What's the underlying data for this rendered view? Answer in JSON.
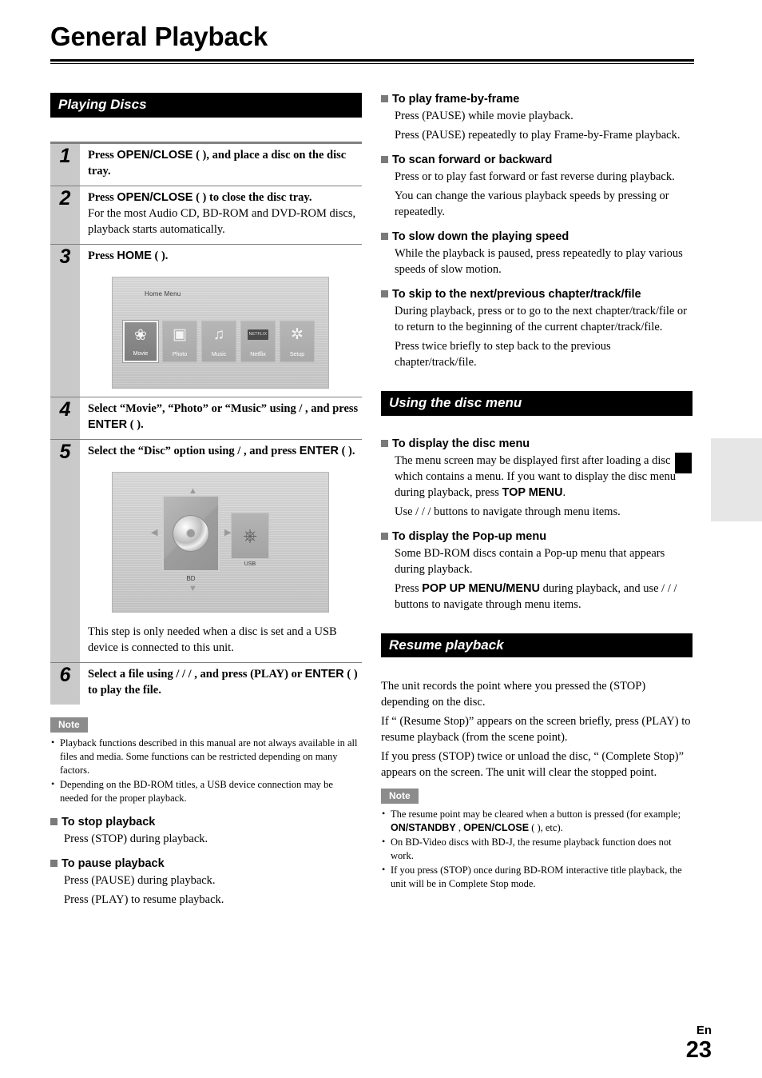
{
  "page": {
    "title": "General Playback",
    "language_code": "En",
    "page_number": "23"
  },
  "left_column": {
    "section_title": "Playing Discs",
    "steps": [
      {
        "number": "1",
        "lead_parts": [
          "Press ",
          "OPEN/CLOSE",
          " (",
          "",
          "), and place a disc on the disc tray."
        ],
        "lead_plain": "Press OPEN/CLOSE ( ), and place a disc on the disc tray.",
        "sub": ""
      },
      {
        "number": "2",
        "lead_plain": "Press OPEN/CLOSE ( ) to close the disc tray.",
        "sub": "For the most Audio CD, BD-ROM and DVD-ROM discs, playback starts automatically."
      },
      {
        "number": "3",
        "lead_plain": "Press HOME ( ).",
        "sub": ""
      },
      {
        "number": "4",
        "lead_plain": "Select “Movie”, “Photo” or “Music” using    /  , and press ENTER (  ).",
        "sub": ""
      },
      {
        "number": "5",
        "lead_plain": "Select the “Disc” option using    /  , and press ENTER (  ).",
        "sub": ""
      },
      {
        "number": "6",
        "lead_plain": "Select a file using   /  /  /  , and press        (PLAY) or ENTER (  ) to play the file.",
        "sub": ""
      }
    ],
    "step1": {
      "press": "Press ",
      "key": "OPEN/CLOSE",
      "tail": " (   ), and place a disc on the disc tray."
    },
    "step2": {
      "press": "Press ",
      "key": "OPEN/CLOSE",
      "tail": " (   ) to close the disc tray.",
      "sub": "For the most Audio CD, BD-ROM and DVD-ROM discs, playback starts automatically."
    },
    "step3": {
      "press": "Press ",
      "key": "HOME",
      "tail": " (    )."
    },
    "step4": {
      "pre": "Select “Movie”, “Photo” or “Music” using     /   , and press ",
      "key": "ENTER",
      "tail": " (    )."
    },
    "step5": {
      "pre": "Select the “Disc” option using     /   , and press ",
      "key": "ENTER",
      "tail": " (    )."
    },
    "step5_note": "This step is only needed when a disc is set and a USB device is connected to this unit.",
    "step6": {
      "pre": "Select a file using    /  /  /   , and press          (PLAY) or ",
      "key": "ENTER",
      "tail": " (   ) to play the file."
    },
    "home_menu_screenshot": {
      "title": "Home Menu",
      "tiles": [
        {
          "label": "Movie",
          "icon": "film-reel-icon",
          "glyph": "❀",
          "selected": true
        },
        {
          "label": "Photo",
          "icon": "photo-icon",
          "glyph": "▣",
          "selected": false
        },
        {
          "label": "Music",
          "icon": "music-note-icon",
          "glyph": "♫",
          "selected": false
        },
        {
          "label": "Netflix",
          "icon": "netflix-icon",
          "glyph": "NETFLIX",
          "selected": false
        },
        {
          "label": "Setup",
          "icon": "gear-icon",
          "glyph": "⚙",
          "selected": false
        }
      ]
    },
    "disc_screenshot": {
      "bd_label": "BD",
      "usb_label": "USB"
    },
    "note": {
      "tag": "Note",
      "items": [
        "Playback functions described in this manual are not always available in all files and media. Some functions can be restricted depending on many factors.",
        "Depending on the BD-ROM titles, a USB device connection may be needed for the proper playback."
      ]
    },
    "topics": [
      {
        "heading": "To stop playback",
        "lines": [
          "Press        (STOP) during playback."
        ]
      },
      {
        "heading": "To pause playback",
        "lines": [
          "Press        (PAUSE) during playback.",
          "Press           (PLAY) to resume playback."
        ]
      }
    ]
  },
  "right_column": {
    "topics_top": [
      {
        "heading": "To play frame-by-frame",
        "lines": [
          "Press        (PAUSE) while movie playback.",
          "Press        (PAUSE) repeatedly to play Frame-by-Frame playback."
        ]
      },
      {
        "heading": "To scan forward or backward",
        "lines": [
          "Press          or           to play fast forward or fast reverse during playback.",
          "You can change the various playback speeds by pressing          or            repeatedly."
        ]
      },
      {
        "heading": "To slow down the playing speed",
        "lines": [
          "While the playback is paused, press            repeatedly to play various speeds of slow motion."
        ]
      },
      {
        "heading": "To skip to the next/previous chapter/track/file",
        "lines": [
          "During playback, press            or            to go to the next chapter/track/file or to return to the beginning of the current chapter/track/file.",
          "Press            twice briefly to step back to the previous chapter/track/file."
        ]
      }
    ],
    "section_disc_menu": {
      "title": "Using the disc menu",
      "topics": [
        {
          "heading": "To display the disc menu",
          "line1_pre": "The menu screen may be displayed first after loading a disc which contains a menu. If you want to display the disc menu during playback, press ",
          "line1_key": "TOP MENU",
          "line1_post": ".",
          "line2": "Use   /  /  /    buttons to navigate through menu items."
        },
        {
          "heading": "To display the Pop-up menu",
          "line1": "Some BD-ROM discs contain a Pop-up menu that appears during playback.",
          "line2_pre": "Press ",
          "line2_key": "POP UP MENU/MENU",
          "line2_post": " during playback, and use   /  /  /    buttons to navigate through menu items."
        }
      ]
    },
    "section_resume": {
      "title": "Resume playback",
      "paragraphs": [
        "The unit records the point where you pressed the       (STOP) depending on the disc.",
        "If “         (Resume Stop)” appears on the screen briefly, press         (PLAY) to resume playback (from the scene point).",
        "If you press       (STOP) twice or unload the disc, “     (Complete Stop)” appears on the screen. The unit will clear the stopped point."
      ],
      "note": {
        "tag": "Note",
        "items": [
          {
            "pre": "The resume point may be cleared when a button is pressed (for example; ",
            "key1": "ON/STANDBY",
            "mid": "        , ",
            "key2": "OPEN/CLOSE",
            "post": " (    ), etc)."
          },
          {
            "plain": "On BD-Video discs with BD-J, the resume playback function does not work."
          },
          {
            "plain": "If you press        (STOP) once during BD-ROM interactive title playback, the unit will be in Complete Stop mode."
          }
        ]
      }
    }
  },
  "colors": {
    "section_bar_bg": "#000000",
    "step_number_band": "#c9c9c9",
    "note_tag_bg": "#8c8c8c",
    "subhead_square": "#7a7a7a",
    "edge_tab": "#e6e6e6"
  }
}
